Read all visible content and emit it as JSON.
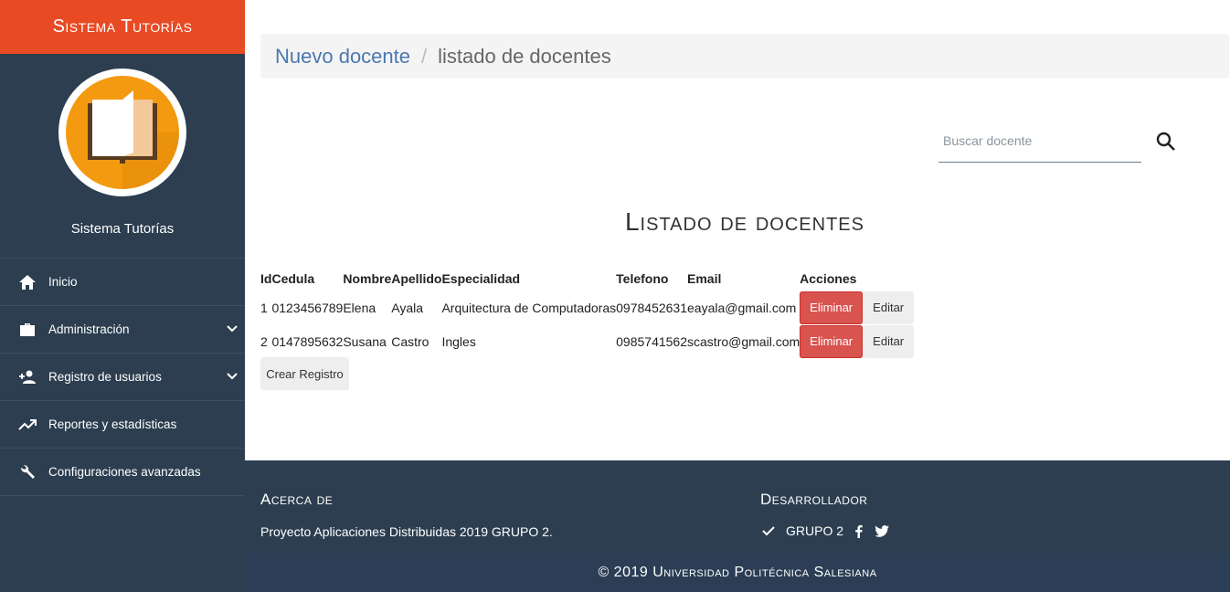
{
  "brand": {
    "title": "Sistema Tutorías",
    "accent": "#e84a24"
  },
  "sidebar": {
    "logo_label": "Sistema Tutorías",
    "items": [
      {
        "label": "Inicio",
        "icon": "home-icon",
        "expandable": false
      },
      {
        "label": "Administración",
        "icon": "briefcase-icon",
        "expandable": true
      },
      {
        "label": "Registro de usuarios",
        "icon": "person-add-icon",
        "expandable": true
      },
      {
        "label": "Reportes y estadísticas",
        "icon": "trending-up-icon",
        "expandable": false
      },
      {
        "label": "Configuraciones avanzadas",
        "icon": "wrench-icon",
        "expandable": false
      }
    ]
  },
  "breadcrumb": {
    "link": "Nuevo docente",
    "separator": "/",
    "current": "listado de docentes"
  },
  "search": {
    "placeholder": "Buscar docente",
    "icon": "search-icon"
  },
  "page_title": "Listado de docentes",
  "table": {
    "headers": [
      "Id",
      "Cedula",
      "Nombre",
      "Apellido",
      "Especialidad",
      "Telefono",
      "Email",
      "Acciones"
    ],
    "rows": [
      {
        "id": "1",
        "cedula": "0123456789",
        "nombre": "Elena",
        "apellido": "Ayala",
        "especialidad": "Arquitectura de Computadoras",
        "telefono": "0978452631",
        "email": "eayala@gmail.com"
      },
      {
        "id": "2",
        "cedula": "0147895632",
        "nombre": "Susana",
        "apellido": "Castro",
        "especialidad": "Ingles",
        "telefono": "0985741562",
        "email": "scastro@gmail.com"
      }
    ],
    "delete_label": "Eliminar",
    "edit_label": "Editar"
  },
  "create_label": "Crear Registro",
  "footer": {
    "about_title": "Acerca de",
    "about_text": "Proyecto Aplicaciones Distribuidas 2019 GRUPO 2.",
    "dev_title": "Desarrollador",
    "dev_name": "GRUPO 2",
    "copyright": "© 2019 Universidad Politécnica Salesiana"
  },
  "colors": {
    "sidebar": "#2c3e50",
    "danger": "#d9534f",
    "link": "#4a78b0"
  }
}
